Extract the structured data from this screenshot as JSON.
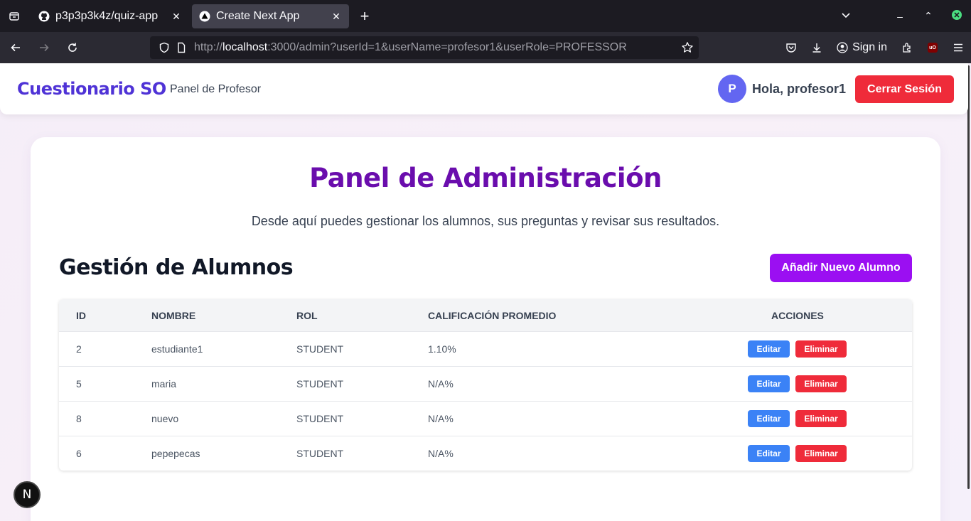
{
  "browser": {
    "tabs": [
      {
        "title": "p3p3p3k4z/quiz-app",
        "icon": "github-icon",
        "active": false
      },
      {
        "title": "Create Next App",
        "icon": "nextjs-icon",
        "active": true
      }
    ],
    "url_prefix": "http://",
    "url_host": "localhost",
    "url_rest": ":3000/admin?userId=1&userName=profesor1&userRole=PROFESSOR",
    "signin_label": "Sign in"
  },
  "header": {
    "brand": "Cuestionario SO",
    "panel_link": "Panel de Profesor",
    "avatar_initial": "P",
    "greeting": "Hola, profesor1",
    "logout_label": "Cerrar Sesión"
  },
  "main": {
    "title": "Panel de Administración",
    "subtitle": "Desde aquí puedes gestionar los alumnos, sus preguntas y revisar sus resultados.",
    "section_title": "Gestión de Alumnos",
    "add_button": "Añadir Nuevo Alumno"
  },
  "table": {
    "headers": [
      "ID",
      "NOMBRE",
      "ROL",
      "CALIFICACIÓN PROMEDIO",
      "ACCIONES"
    ],
    "rows": [
      {
        "id": "2",
        "name": "estudiante1",
        "role": "STUDENT",
        "grade": "1.10%"
      },
      {
        "id": "5",
        "name": "maria",
        "role": "STUDENT",
        "grade": "N/A%"
      },
      {
        "id": "8",
        "name": "nuevo",
        "role": "STUDENT",
        "grade": "N/A%"
      },
      {
        "id": "6",
        "name": "pepepecas",
        "role": "STUDENT",
        "grade": "N/A%"
      }
    ],
    "edit_label": "Editar",
    "delete_label": "Eliminar"
  },
  "next_badge": "N",
  "colors": {
    "brand": "#4f33d6",
    "title": "#6a0dad",
    "add_button": "#9b0ff2",
    "danger": "#ef2b3a",
    "edit": "#3b82f6"
  }
}
